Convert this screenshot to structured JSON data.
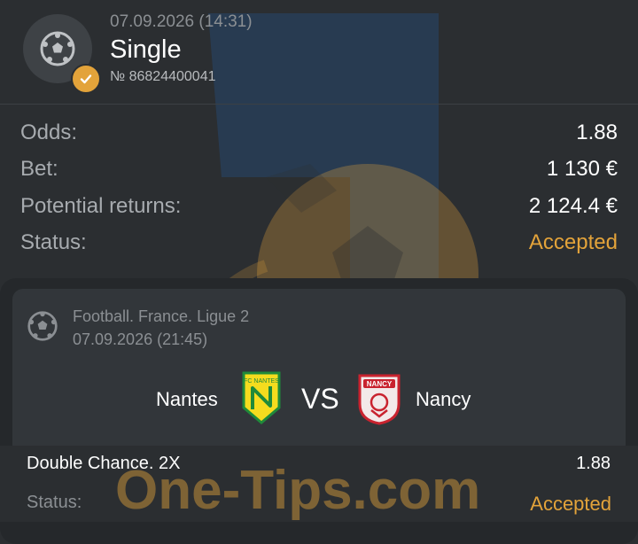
{
  "ticket": {
    "date": "07.09.2026 (14:31)",
    "title": "Single",
    "number": "№ 86824400041"
  },
  "summary": {
    "odds_label": "Odds:",
    "odds_value": "1.88",
    "bet_label": "Bet:",
    "bet_value": "1 130 €",
    "returns_label": "Potential returns:",
    "returns_value": "2 124.4 €",
    "status_label": "Status:",
    "status_value": "Accepted"
  },
  "event": {
    "league": "Football. France. Ligue 2",
    "date": "07.09.2026 (21:45)",
    "home_team": "Nantes",
    "away_team": "Nancy",
    "vs": "VS",
    "home_logo_text": "FC NANTES",
    "away_logo_text": "NANCY"
  },
  "selection": {
    "pick": "Double Chance. 2X",
    "odds": "1.88",
    "status_label": "Status:",
    "status_value": "Accepted"
  },
  "watermark": {
    "text": "One-Tips.com"
  },
  "colors": {
    "accent": "#e3a33a",
    "background": "#2b2e31",
    "card": "#32363a",
    "watermark_blue": "#1f5fa6",
    "watermark_orange": "#e3a33a"
  },
  "icons": {
    "ticket": "football-icon",
    "badge": "check-icon",
    "event": "football-icon"
  }
}
